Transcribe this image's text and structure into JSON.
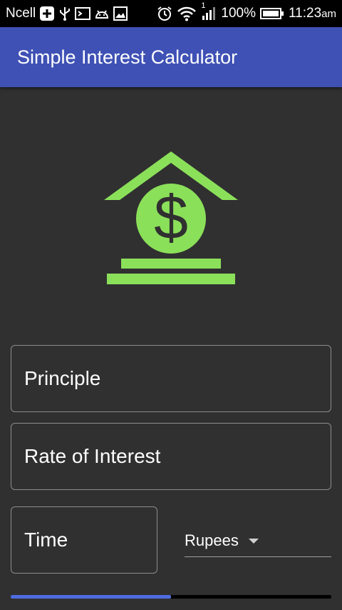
{
  "status_bar": {
    "carrier": "Ncell",
    "sim_indicator": "1",
    "battery": "100%",
    "time": "11:23",
    "time_suffix": "am",
    "icons": [
      "plus-box-icon",
      "usb-icon",
      "terminal-icon",
      "android-icon",
      "image-icon",
      "alarm-icon",
      "wifi-icon",
      "signal-icon",
      "battery-icon"
    ]
  },
  "app_bar": {
    "title": "Simple Interest Calculator",
    "color": "#3F51B5"
  },
  "logo": {
    "icon": "bank-dollar-icon",
    "glyph": "$",
    "color": "#8BE05A"
  },
  "form": {
    "principle_placeholder": "Principle",
    "rate_placeholder": "Rate of Interest",
    "time_placeholder": "Time",
    "currency_selected": "Rupees"
  },
  "progress": {
    "value_fraction": 0.5,
    "color": "#4F6BE0"
  }
}
